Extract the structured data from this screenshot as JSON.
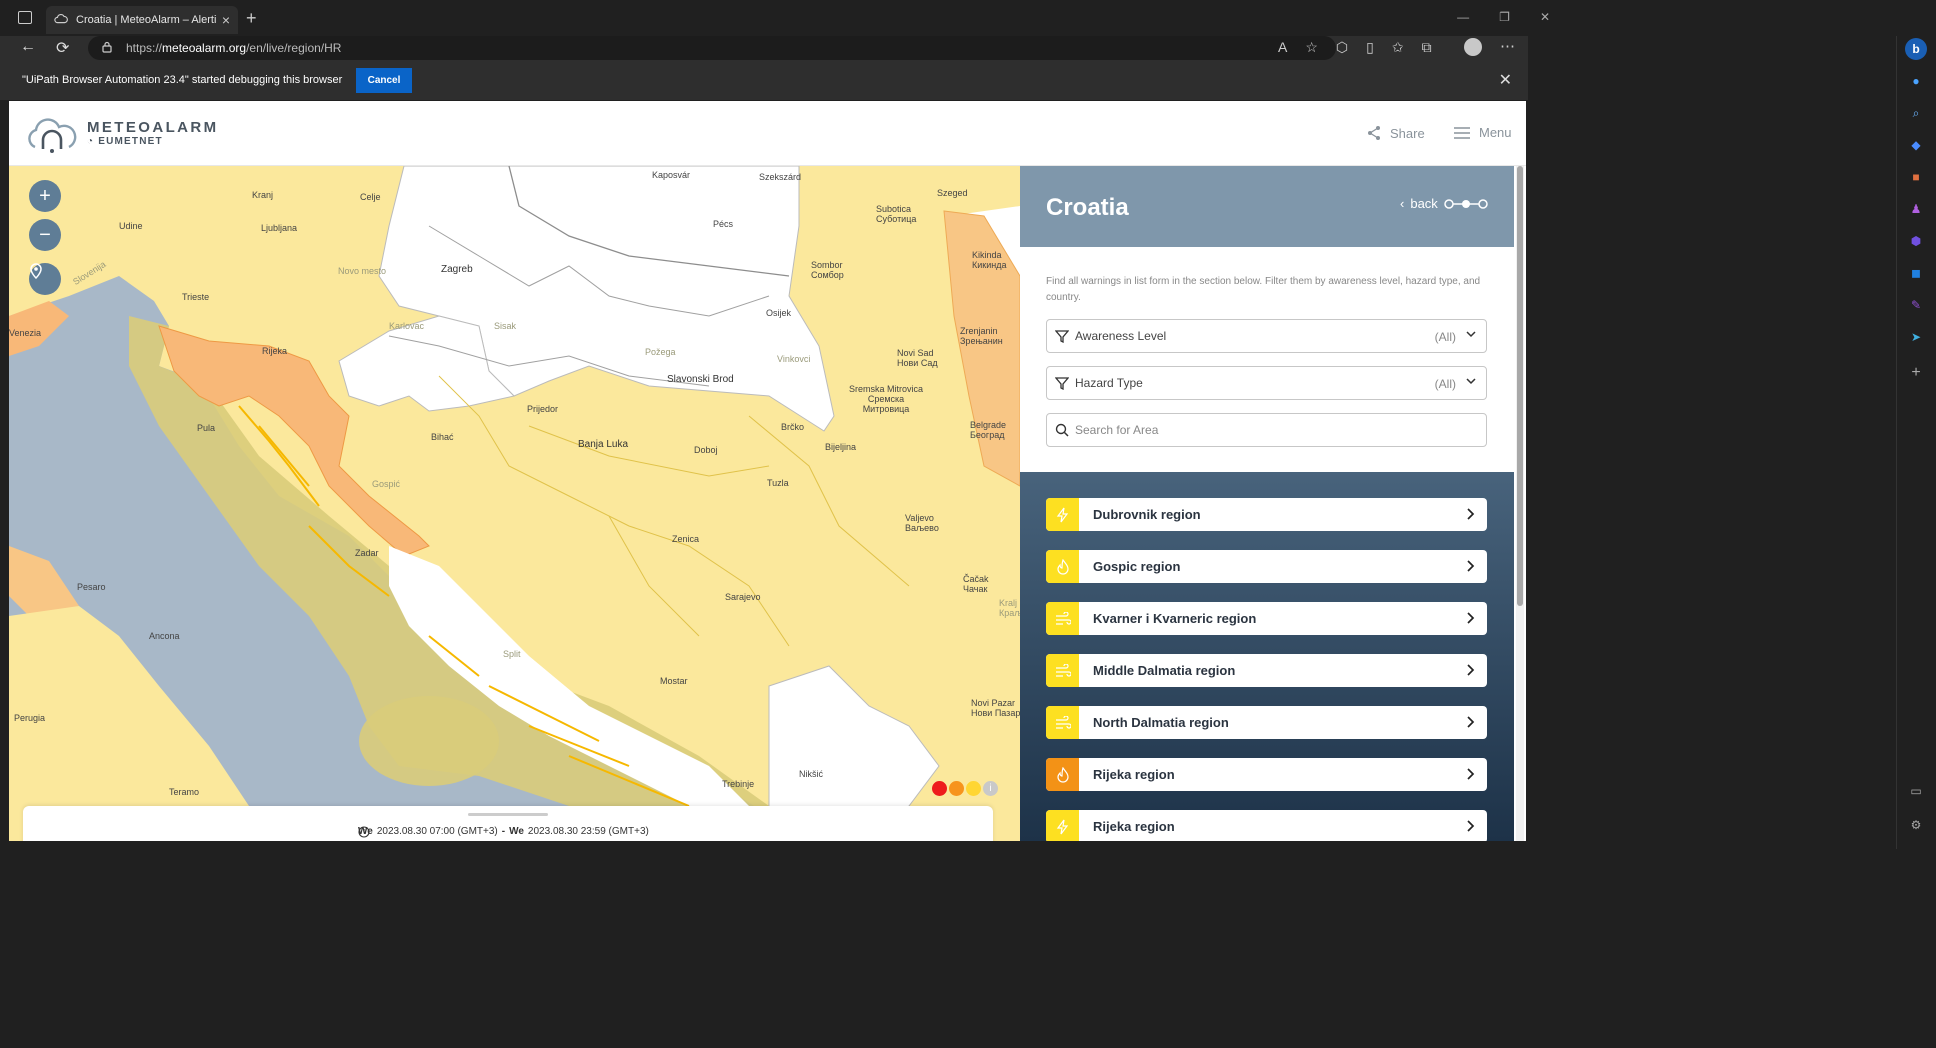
{
  "browser": {
    "tab_title": "Croatia | MeteoAlarm – Alerting E",
    "url_prefix": "https://",
    "url_host": "meteoalarm.org",
    "url_path": "/en/live/region/HR"
  },
  "infobar": {
    "message": "\"UiPath Browser Automation 23.4\" started debugging this browser",
    "cancel_label": "Cancel"
  },
  "header": {
    "logo_title": "METEOALARM",
    "logo_sub": "EUMETNET",
    "share_label": "Share",
    "menu_label": "Menu"
  },
  "map": {
    "labels": {
      "kaposvar": "Kaposvár",
      "szekszard": "Szekszárd",
      "szeged": "Szeged",
      "subotica": "Subotica\nСуботица",
      "kranj": "Kranj",
      "celje": "Celje",
      "udine": "Udine",
      "ljubljana": "Ljubljana",
      "pecs": "Pécs",
      "zagreb": "Zagreb",
      "sombor": "Sombor\nСомбор",
      "kikinda": "Kikinda\nКикинда",
      "trieste": "Trieste",
      "novo_mesto": "Novo mesto",
      "osijek": "Osijek",
      "karlovac": "Karlovac",
      "sisak": "Sisak",
      "zrenjanin": "Zrenjanin\nЗрењанин",
      "rijeka": "Rijeka",
      "pozega": "Požega",
      "vinkovci": "Vinkovci",
      "novi_sad": "Novi Sad\nНови Сад",
      "slavonski_brod": "Slavonski Brod",
      "sremska": "Sremska Mitrovica\nСремска\nМитровица",
      "venezia": "Venezia",
      "prijedor": "Prijedor",
      "pula": "Pula",
      "bihac": "Bihać",
      "brcko": "Brčko",
      "belgrade": "Belgrade\nБеоград",
      "banja_luka": "Banja Luka",
      "doboj": "Doboj",
      "bijeljina": "Bijeljina",
      "tuzla": "Tuzla",
      "valjevo": "Valjevo\nВаљево",
      "zenica": "Zenica",
      "zadar": "Zadar",
      "cacak": "Čačak\nЧачак",
      "pesaro": "Pesaro",
      "sarajevo": "Sarajevo",
      "ancona": "Ancona",
      "split": "Split",
      "mostar": "Mostar",
      "novi_pazar": "Novi Pazar\nНови Пазар",
      "perugia": "Perugia",
      "niksic": "Nikšić",
      "trebinje": "Trebinje",
      "teramo": "Teramo",
      "gospic": "Gospić",
      "kralj": "Kralj\nКраљ",
      "slovenia_label": "Slovenija"
    }
  },
  "legend_colors": [
    "#ee1c1c",
    "#f7941d",
    "#ffd633"
  ],
  "time": {
    "from_day": "We",
    "from_value": "2023.08.30 07:00 (GMT+3)",
    "separator": "-",
    "to_day": "We",
    "to_value": "2023.08.30 23:59 (GMT+3)"
  },
  "panel": {
    "title": "Croatia",
    "back_label": "back",
    "hint": "Find all warnings in list form in the section below. Filter them by awareness level, hazard type, and country.",
    "awareness_label": "Awareness Level",
    "awareness_value": "(All)",
    "hazard_label": "Hazard Type",
    "hazard_value": "(All)",
    "search_placeholder": "Search for Area",
    "regions": [
      {
        "name": "Dubrovnik region",
        "icon": "thunderstorm-icon",
        "color": "#fde021"
      },
      {
        "name": "Gospic region",
        "icon": "fire-icon",
        "color": "#fde021"
      },
      {
        "name": "Kvarner i Kvarneric region",
        "icon": "wind-icon",
        "color": "#fde021"
      },
      {
        "name": "Middle Dalmatia region",
        "icon": "wind-icon",
        "color": "#fde021"
      },
      {
        "name": "North Dalmatia region",
        "icon": "wind-icon",
        "color": "#fde021"
      },
      {
        "name": "Rijeka region",
        "icon": "fire-icon",
        "color": "#f39216"
      },
      {
        "name": "Rijeka region",
        "icon": "thunderstorm-icon",
        "color": "#fde021"
      }
    ]
  }
}
